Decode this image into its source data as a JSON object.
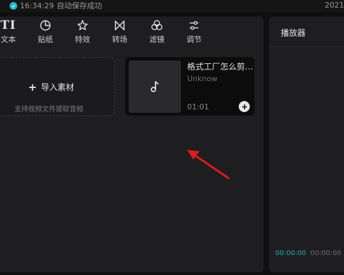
{
  "status": {
    "time": "16:34:29",
    "message": "自动保存成功",
    "date": "2021"
  },
  "toolbar": {
    "items": [
      {
        "icon": "text-icon",
        "label": "文本"
      },
      {
        "icon": "sticker-icon",
        "label": "贴纸"
      },
      {
        "icon": "effects-icon",
        "label": "特效"
      },
      {
        "icon": "transition-icon",
        "label": "转场"
      },
      {
        "icon": "filter-icon",
        "label": "滤镜"
      },
      {
        "icon": "adjust-icon",
        "label": "调节"
      }
    ],
    "text_icon_glyph": "TI"
  },
  "import": {
    "label": "导入素材",
    "hint": "支持视频文件提取音频"
  },
  "media": {
    "title": "格式工厂怎么剪…",
    "artist": "Unknow",
    "duration": "01:01"
  },
  "player": {
    "title": "播放器",
    "current_time": "00:00:00",
    "total_time": "00:00:00"
  },
  "colors": {
    "accent": "#22b8cf",
    "annotation_arrow": "#e01b1b"
  }
}
